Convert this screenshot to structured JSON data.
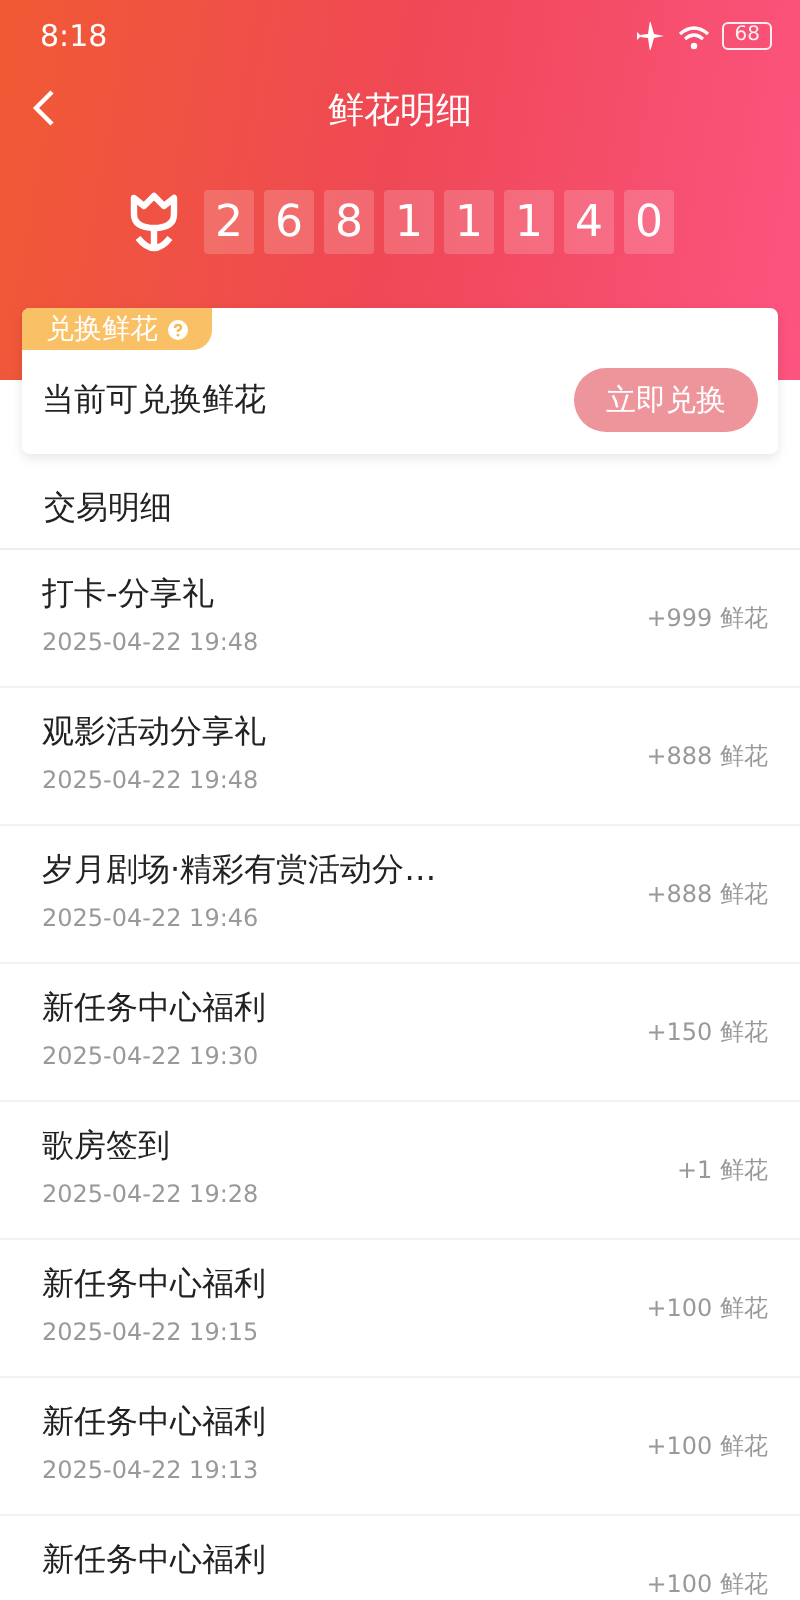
{
  "status_bar": {
    "time": "8:18",
    "battery": "68"
  },
  "header": {
    "title": "鲜花明细",
    "digits": [
      "2",
      "6",
      "8",
      "1",
      "1",
      "1",
      "4",
      "0"
    ]
  },
  "exchange_card": {
    "tag": "兑换鲜花",
    "label": "当前可兑换鲜花",
    "button": {
      "label": "立即兑换",
      "disabled": true
    }
  },
  "section_title": "交易明细",
  "transactions": [
    {
      "title": "打卡-分享礼",
      "date": "2025-04-22 19:48",
      "amount": "+999 鲜花"
    },
    {
      "title": "观影活动分享礼",
      "date": "2025-04-22 19:48",
      "amount": "+888 鲜花"
    },
    {
      "title": "岁月剧场·精彩有赏活动分…",
      "date": "2025-04-22 19:46",
      "amount": "+888 鲜花"
    },
    {
      "title": "新任务中心福利",
      "date": "2025-04-22 19:30",
      "amount": "+150 鲜花"
    },
    {
      "title": "歌房签到",
      "date": "2025-04-22 19:28",
      "amount": "+1 鲜花"
    },
    {
      "title": "新任务中心福利",
      "date": "2025-04-22 19:15",
      "amount": "+100 鲜花"
    },
    {
      "title": "新任务中心福利",
      "date": "2025-04-22 19:13",
      "amount": "+100 鲜花"
    },
    {
      "title": "新任务中心福利",
      "amount": "+100 鲜花"
    }
  ]
}
